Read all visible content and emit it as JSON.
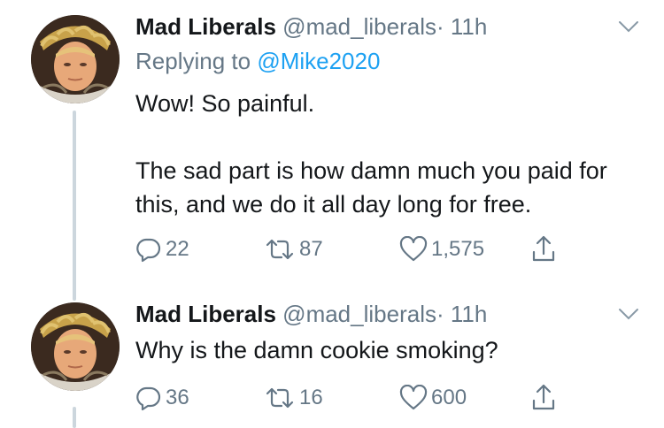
{
  "tweets": [
    {
      "name": "Mad Liberals",
      "handle": "@mad_liberals",
      "dot": "·",
      "time": "11h",
      "replying_prefix": "Replying to ",
      "replying_to": "@Mike2020",
      "body_lines": [
        "Wow! So painful.",
        "The sad part is how damn much you paid for this, and we do it all day long for free."
      ],
      "replies": "22",
      "retweets": "87",
      "likes": "1,575"
    },
    {
      "name": "Mad Liberals",
      "handle": "@mad_liberals",
      "dot": "·",
      "time": "11h",
      "body_lines": [
        "Why is the damn cookie smoking?"
      ],
      "replies": "36",
      "retweets": "16",
      "likes": "600"
    }
  ],
  "icons": {
    "reply": "reply-icon",
    "retweet": "retweet-icon",
    "like": "heart-icon",
    "share": "share-icon",
    "caret": "chevron-down-icon"
  },
  "colors": {
    "text": "#14171a",
    "muted": "#657786",
    "link": "#1da1f2",
    "thread_line": "#ccd6dd"
  }
}
